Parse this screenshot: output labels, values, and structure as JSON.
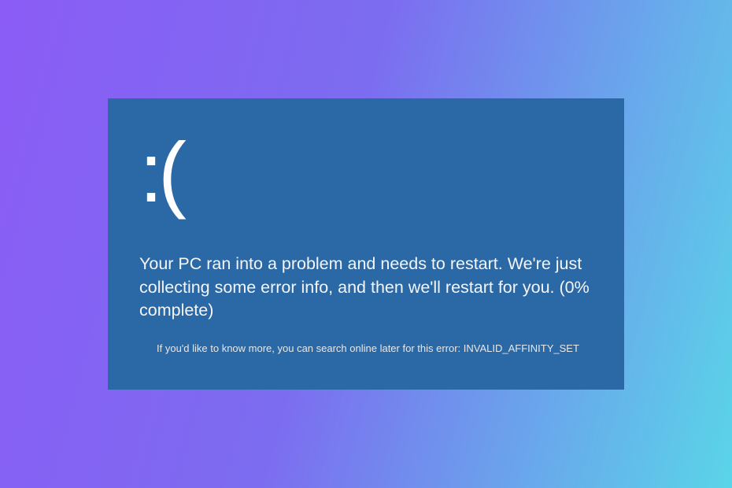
{
  "bsod": {
    "sad_face": ":(",
    "main_message": "Your PC ran into a problem and needs to restart. We're just collecting some error info, and then we'll restart for you. (0% complete)",
    "sub_message_prefix": "If you'd like to know more, you can search online later for this error: ",
    "error_code": "INVALID_AFFINITY_SET"
  }
}
